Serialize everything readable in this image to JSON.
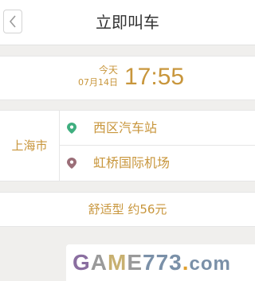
{
  "header": {
    "title": "立即叫车"
  },
  "time": {
    "day": "今天",
    "date": "07月14日",
    "clock": "17:55"
  },
  "route": {
    "city": "上海市",
    "from": "西区汽车站",
    "to": "虹桥国际机场"
  },
  "price": {
    "text": "舒适型 约56元"
  },
  "watermark": {
    "text": "GAME773.com"
  },
  "colors": {
    "accent": "#c8963c",
    "from_pin": "#3fae7f",
    "to_pin": "#9b6e78",
    "background": "#f0efed"
  }
}
